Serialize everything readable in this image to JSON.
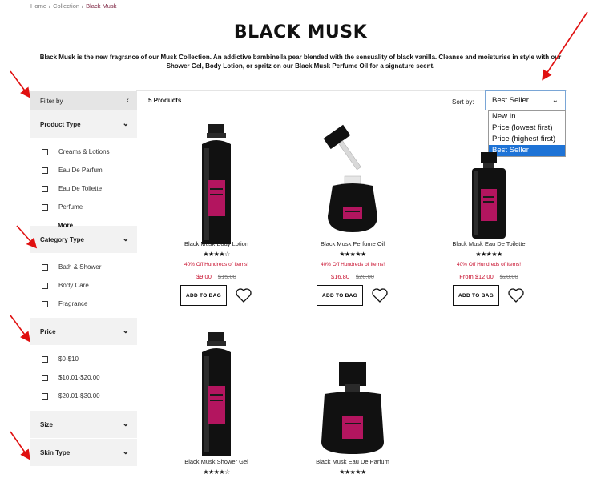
{
  "breadcrumb": {
    "home": "Home",
    "collection": "Collection",
    "current": "Black Musk"
  },
  "page": {
    "title": "BLACK MUSK",
    "intro": "Black Musk is the new fragrance of our Musk Collection. An addictive bambinella pear blended with the sensuality of black vanilla. Cleanse and moisturise in style with our Shower Gel, Body Lotion, or spritz on our Black Musk Perfume Oil for a signature scent."
  },
  "sidebar": {
    "filter_label": "Filter by",
    "product_type": {
      "label": "Product Type",
      "options": [
        "Creams & Lotions",
        "Eau De Parfum",
        "Eau De Toilette",
        "Perfume"
      ],
      "more": "More"
    },
    "category_type": {
      "label": "Category Type",
      "options": [
        "Bath & Shower",
        "Body Care",
        "Fragrance"
      ]
    },
    "price": {
      "label": "Price",
      "options": [
        "$0-$10",
        "$10.01-$20.00",
        "$20.01-$30.00"
      ]
    },
    "size": {
      "label": "Size"
    },
    "skin_type": {
      "label": "Skin Type"
    }
  },
  "listing": {
    "count": "5 Products",
    "sort_label": "Sort by:",
    "sort_selected": "Best Seller",
    "sort_options": [
      "New In",
      "Price (lowest first)",
      "Price (highest first)",
      "Best Seller"
    ]
  },
  "products": [
    {
      "name": "Black Musk Body Lotion",
      "stars": "★★★★☆",
      "rating": 4.5,
      "promo": "40% Off Hundreds of Items!",
      "price": "$9.00",
      "was": "$15.00",
      "button": "ADD TO BAG"
    },
    {
      "name": "Black Musk Perfume Oil",
      "stars": "★★★★★",
      "rating": 5,
      "promo": "40% Off Hundreds of Items!",
      "price": "$16.80",
      "was": "$28.00",
      "button": "ADD TO BAG"
    },
    {
      "name": "Black Musk Eau De Toilette",
      "stars": "★★★★★",
      "rating": 5,
      "promo": "40% Off Hundreds of Items!",
      "price": "From $12.00",
      "was": "$20.00",
      "button": "ADD TO BAG"
    },
    {
      "name": "Black Musk Shower Gel",
      "stars": "★★★★☆",
      "rating": 4,
      "promo": "",
      "price": "",
      "was": "",
      "button": ""
    },
    {
      "name": "Black Musk Eau De Parfum",
      "stars": "★★★★★",
      "rating": 5,
      "promo": "",
      "price": "",
      "was": "",
      "button": ""
    }
  ],
  "colors": {
    "accent_red": "#c8102e",
    "label_magenta": "#b3155f",
    "annotation_arrow": "#e01010",
    "select_blue": "#1e73d6"
  }
}
